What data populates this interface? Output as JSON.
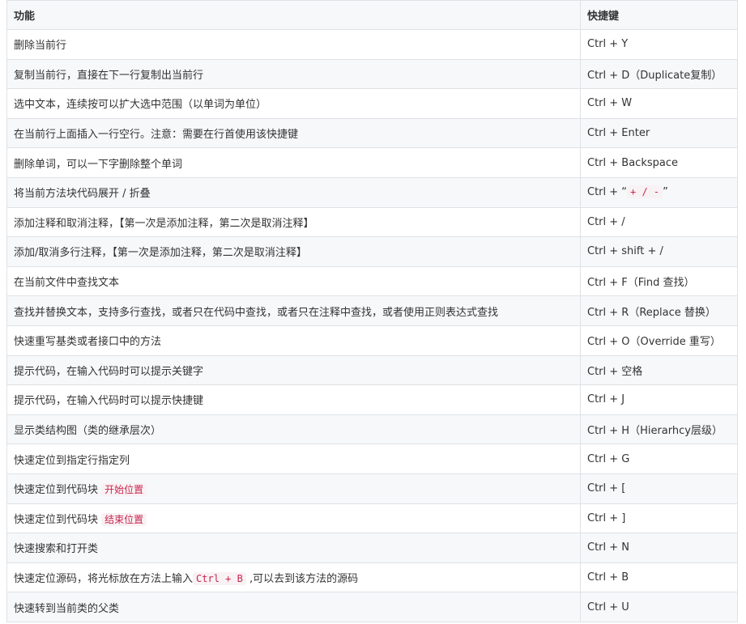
{
  "table": {
    "headers": {
      "feature": "功能",
      "shortcut": "快捷键"
    },
    "rows": [
      {
        "feature": "删除当前行",
        "shortcut": "Ctrl + Y"
      },
      {
        "feature": "复制当前行，直接在下一行复制出当前行",
        "shortcut": "Ctrl + D（Duplicate复制）"
      },
      {
        "feature": "选中文本，连续按可以扩大选中范围（以单词为单位）",
        "shortcut": "Ctrl + W"
      },
      {
        "feature": "在当前行上面插入一行空行。注意：需要在行首使用该快捷键",
        "shortcut": "Ctrl + Enter"
      },
      {
        "feature": "删除单词，可以一下字删除整个单词",
        "shortcut": "Ctrl + Backspace"
      },
      {
        "feature": "将当前方法块代码展开 / 折叠",
        "shortcut_pre": "Ctrl + “",
        "shortcut_code": "+ / -",
        "shortcut_post": "”"
      },
      {
        "feature": "添加注释和取消注释，【第一次是添加注释，第二次是取消注释】",
        "shortcut": "Ctrl + /"
      },
      {
        "feature": "添加/取消多行注释，【第一次是添加注释，第二次是取消注释】",
        "shortcut": "Ctrl + shift + /"
      },
      {
        "feature": "在当前文件中查找文本",
        "shortcut": "Ctrl + F（Find 查找）"
      },
      {
        "feature": "查找并替换文本，支持多行查找，或者只在代码中查找，或者只在注释中查找，或者使用正则表达式查找",
        "shortcut": "Ctrl + R（Replace 替换）"
      },
      {
        "feature": "快速重写基类或者接口中的方法",
        "shortcut": "Ctrl + O（Override 重写）"
      },
      {
        "feature": "提示代码，在输入代码时可以提示关键字",
        "shortcut": "Ctrl + 空格"
      },
      {
        "feature": "提示代码，在输入代码时可以提示快捷键",
        "shortcut": "Ctrl + J"
      },
      {
        "feature": "显示类结构图（类的继承层次）",
        "shortcut": "Ctrl + H（Hierarhcy层级）"
      },
      {
        "feature": "快速定位到指定行指定列",
        "shortcut": "Ctrl + G"
      },
      {
        "feature_pre": "快速定位到代码块 ",
        "feature_code": "开始位置",
        "shortcut": "Ctrl + ["
      },
      {
        "feature_pre": "快速定位到代码块 ",
        "feature_code": "结束位置",
        "shortcut": "Ctrl + ]"
      },
      {
        "feature": "快速搜索和打开类",
        "shortcut": "Ctrl + N"
      },
      {
        "feature_pre": "快速定位源码，将光标放在方法上输入",
        "feature_code": "Ctrl + B",
        "feature_post": " ,可以去到该方法的源码",
        "shortcut": "Ctrl + B"
      },
      {
        "feature": "快速转到当前类的父类",
        "shortcut": "Ctrl + U"
      }
    ]
  }
}
